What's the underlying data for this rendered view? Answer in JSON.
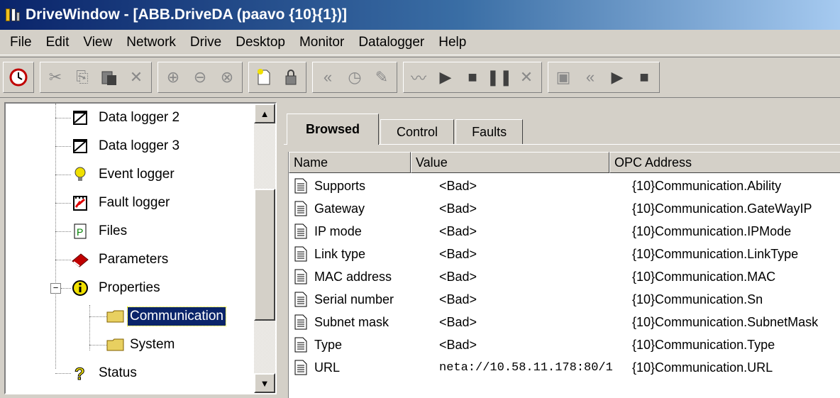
{
  "window": {
    "title": "DriveWindow - [ABB.DriveDA (paavo {10}{1})]"
  },
  "menu": [
    "File",
    "Edit",
    "View",
    "Network",
    "Drive",
    "Desktop",
    "Monitor",
    "Datalogger",
    "Help"
  ],
  "toolbar": {
    "icons": [
      "connect-icon",
      "cut-icon",
      "copy-icon",
      "paste-icon",
      "delete-icon",
      "zoom-in-icon",
      "zoom-out-icon",
      "zoom-reset-icon",
      "new-document-icon",
      "lock-icon",
      "rewind-icon",
      "clock-icon",
      "edit-icon",
      "chart-icon",
      "play-icon",
      "stop-icon",
      "pause-icon",
      "clear-icon",
      "window-icon",
      "rewind-2-icon",
      "play-2-icon",
      "stop-2-icon"
    ]
  },
  "tree": {
    "items": [
      {
        "label": "Data logger 2",
        "icon": "data-logger-icon"
      },
      {
        "label": "Data logger 3",
        "icon": "data-logger-icon"
      },
      {
        "label": "Event logger",
        "icon": "lightbulb-icon"
      },
      {
        "label": "Fault logger",
        "icon": "fault-logger-icon"
      },
      {
        "label": "Files",
        "icon": "file-p-icon"
      },
      {
        "label": "Parameters",
        "icon": "book-icon"
      },
      {
        "label": "Properties",
        "icon": "info-icon",
        "expander": "−"
      },
      {
        "label": "Communication",
        "icon": "folder-icon",
        "selected": true
      },
      {
        "label": "System",
        "icon": "folder-icon"
      },
      {
        "label": "Status",
        "icon": "question-icon"
      }
    ]
  },
  "tabs": [
    "Browsed",
    "Control",
    "Faults"
  ],
  "active_tab": "Browsed",
  "table": {
    "columns": [
      "Name",
      "Value",
      "OPC Address"
    ],
    "rows": [
      {
        "name": "Supports",
        "value": "<Bad>",
        "opc": "{10}Communication.Ability"
      },
      {
        "name": "Gateway",
        "value": "<Bad>",
        "opc": "{10}Communication.GateWayIP"
      },
      {
        "name": "IP mode",
        "value": "<Bad>",
        "opc": "{10}Communication.IPMode"
      },
      {
        "name": "Link type",
        "value": "<Bad>",
        "opc": "{10}Communication.LinkType"
      },
      {
        "name": "MAC address",
        "value": "<Bad>",
        "opc": "{10}Communication.MAC"
      },
      {
        "name": "Serial number",
        "value": "<Bad>",
        "opc": "{10}Communication.Sn"
      },
      {
        "name": "Subnet mask",
        "value": "<Bad>",
        "opc": "{10}Communication.SubnetMask"
      },
      {
        "name": "Type",
        "value": "<Bad>",
        "opc": "{10}Communication.Type"
      },
      {
        "name": "URL",
        "value": "neta://10.58.11.178:80/1",
        "opc": "{10}Communication.URL"
      }
    ]
  },
  "colors": {
    "selection": "#0a246a",
    "title_start": "#0a246a",
    "title_end": "#a6caf0",
    "face": "#d4d0c8"
  }
}
